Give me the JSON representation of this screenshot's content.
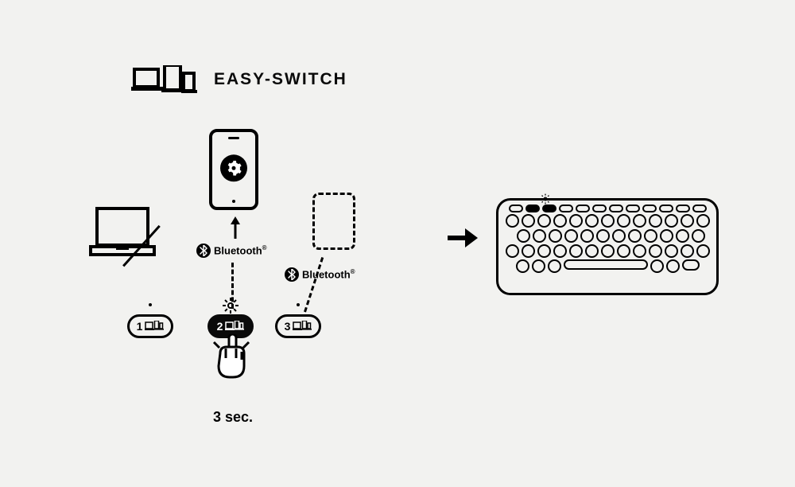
{
  "title": "EASY-SWITCH",
  "bluetooth_label": "Bluetooth",
  "keys": {
    "k1": "1",
    "k2": "2",
    "k3": "3"
  },
  "duration_label": "3 sec.",
  "icons": {
    "title_devices": "devices-icon",
    "smartphone": "smartphone-icon",
    "gear": "gear-icon",
    "laptop": "laptop-icon",
    "dashed_placeholder": "placeholder-device-icon",
    "bluetooth": "bluetooth-icon",
    "sun": "brightness-icon",
    "hand": "hand-press-icon",
    "arrow_up": "arrow-up-icon",
    "arrow_right": "arrow-right-icon",
    "keyboard": "keyboard-icon"
  }
}
